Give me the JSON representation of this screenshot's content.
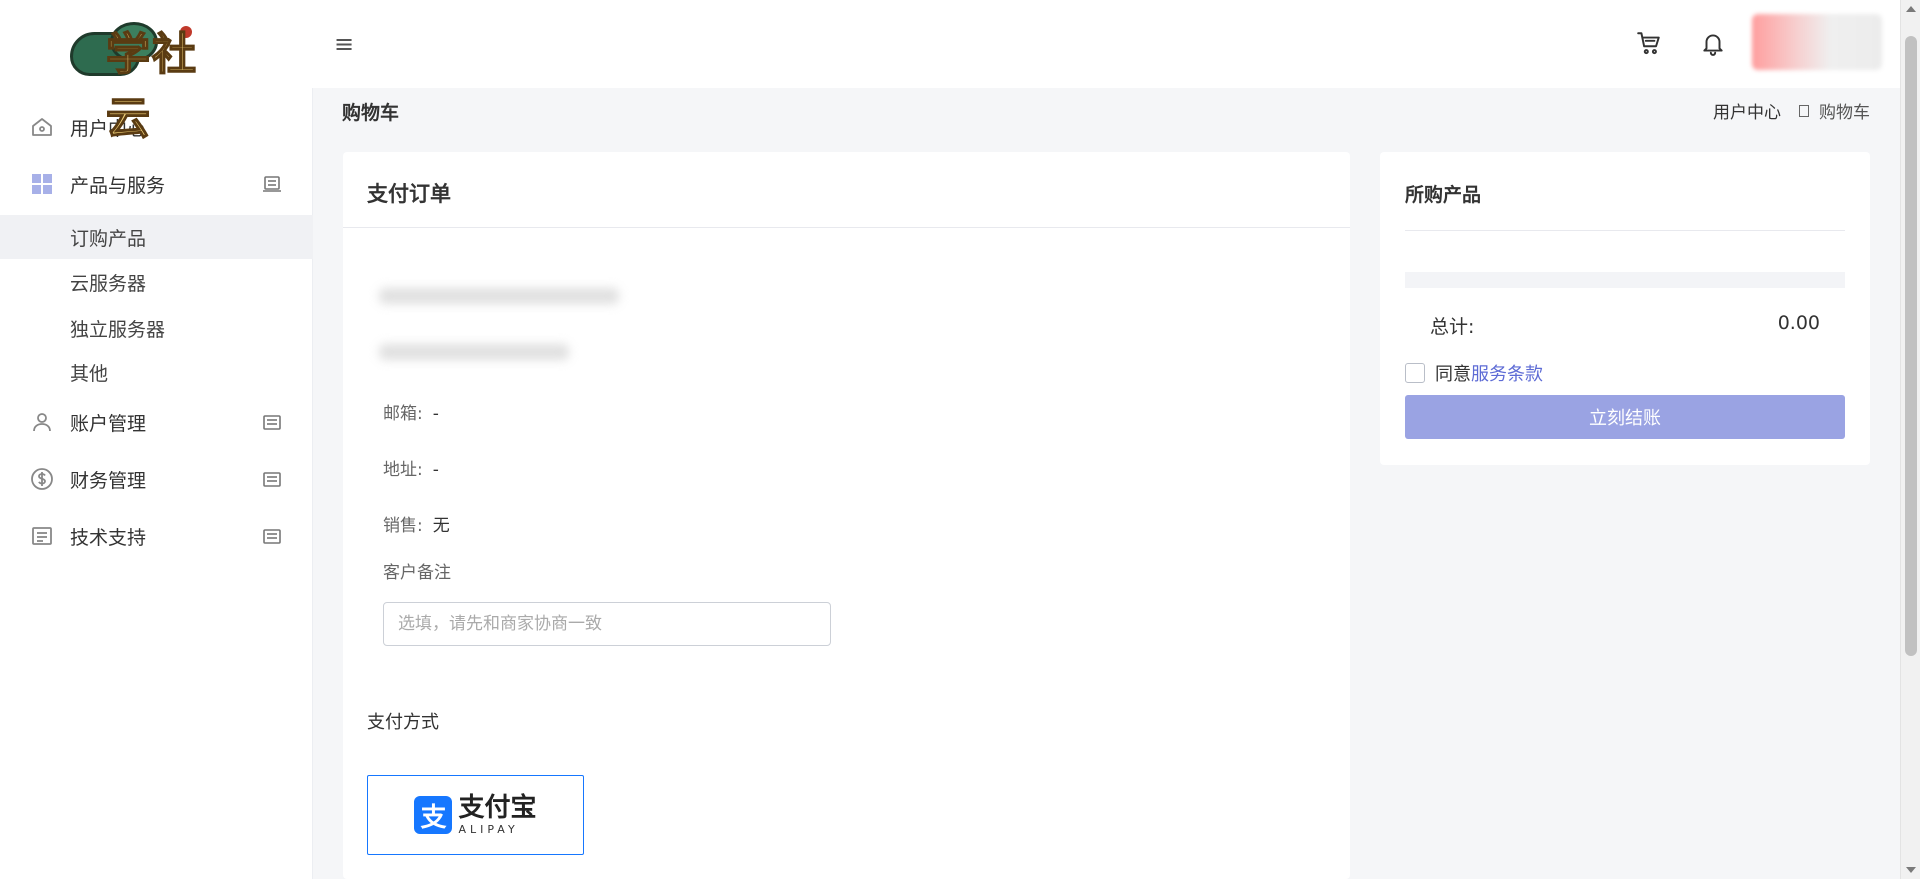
{
  "brand": {
    "logo_text": "学社云"
  },
  "topbar": {
    "menu_icon": "menu-icon",
    "cart_icon": "cart-icon",
    "bell_icon": "bell-icon"
  },
  "sidebar": {
    "items": [
      {
        "label": "用户中心",
        "icon": "home-icon"
      },
      {
        "label": "产品与服务",
        "icon": "grid-icon"
      },
      {
        "label": "账户管理",
        "icon": "user-icon"
      },
      {
        "label": "财务管理",
        "icon": "dollar-icon"
      },
      {
        "label": "技术支持",
        "icon": "document-icon"
      }
    ],
    "subitems": [
      "订购产品",
      "云服务器",
      "独立服务器",
      "其他"
    ]
  },
  "page": {
    "title": "购物车",
    "breadcrumb": [
      "用户中心",
      "购物车"
    ]
  },
  "order": {
    "title": "支付订单",
    "email_label": "邮箱:",
    "email_value": "-",
    "address_label": "地址:",
    "address_value": "-",
    "sales_label": "销售:",
    "sales_value": "无",
    "note_label": "客户备注",
    "note_placeholder": "选填，请先和商家协商一致",
    "payment_label": "支付方式",
    "alipay_cn": "支付宝",
    "alipay_en": "ALIPAY",
    "alipay_mark": "支"
  },
  "summary": {
    "title": "所购产品",
    "total_label": "总计:",
    "total_value": "0.00",
    "agree_text": "同意",
    "terms_link": "服务条款",
    "checkout_label": "立刻结账"
  },
  "colors": {
    "accent": "#9aa3e3",
    "link": "#5d6bd5",
    "alipay": "#1677ff"
  }
}
